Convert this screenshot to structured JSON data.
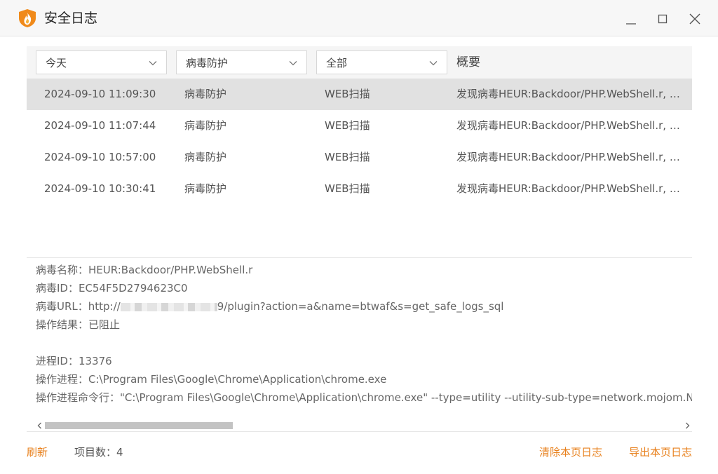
{
  "window": {
    "title": "安全日志",
    "icon": "fire-shield-icon",
    "controls": [
      "minimize-icon",
      "maximize-icon",
      "close-icon"
    ]
  },
  "filters": {
    "date": "今天",
    "category": "病毒防护",
    "source": "全部",
    "summary_header": "概要"
  },
  "logs": [
    {
      "time": "2024-09-10 11:09:30",
      "type": "病毒防护",
      "source": "WEB扫描",
      "summary": "发现病毒HEUR:Backdoor/PHP.WebShell.r, 已…",
      "selected": true
    },
    {
      "time": "2024-09-10 11:07:44",
      "type": "病毒防护",
      "source": "WEB扫描",
      "summary": "发现病毒HEUR:Backdoor/PHP.WebShell.r, 已…",
      "selected": false
    },
    {
      "time": "2024-09-10 10:57:00",
      "type": "病毒防护",
      "source": "WEB扫描",
      "summary": "发现病毒HEUR:Backdoor/PHP.WebShell.r, 已…",
      "selected": false
    },
    {
      "time": "2024-09-10 10:30:41",
      "type": "病毒防护",
      "source": "WEB扫描",
      "summary": "发现病毒HEUR:Backdoor/PHP.WebShell.r, 已…",
      "selected": false
    }
  ],
  "detail": {
    "virus_name": "病毒名称：HEUR:Backdoor/PHP.WebShell.r",
    "virus_id": "病毒ID：EC54F5D2794623C0",
    "virus_url_prefix": "病毒URL：http://",
    "virus_url_suffix": "9/plugin?action=a&name=btwaf&s=get_safe_logs_sql",
    "result": "操作结果：已阻止",
    "process_id": "进程ID：13376",
    "process": "操作进程：C:\\Program Files\\Google\\Chrome\\Application\\chrome.exe",
    "command_line": "操作进程命令行：\"C:\\Program Files\\Google\\Chrome\\Application\\chrome.exe\" --type=utility --utility-sub-type=network.mojom.Ne"
  },
  "footer": {
    "refresh": "刷新",
    "item_count": "项目数：4",
    "clear_page": "清除本页日志",
    "export_page": "导出本页日志"
  },
  "colors": {
    "accent": "#e8801c",
    "selected_row": "#e1e1e1"
  }
}
